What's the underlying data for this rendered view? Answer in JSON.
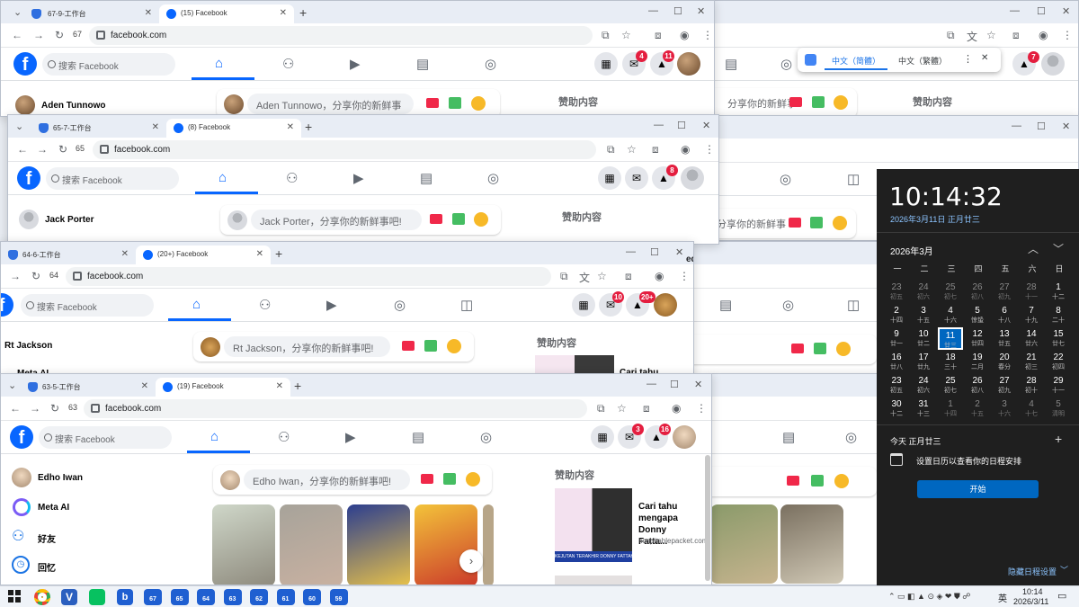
{
  "windows": {
    "w67": {
      "tab1": "67-9-工作台",
      "tab2": "(15) Facebook",
      "url": "facebook.com",
      "count": "67",
      "user": "Aden Tunnowo",
      "composer": "Aden Tunnowo，分享你的新鲜事",
      "sponsored": "赞助内容",
      "search": "搜索 Facebook",
      "badge_msg": "4",
      "badge_notif": "11"
    },
    "w65": {
      "tab1": "65-7-工作台",
      "tab2": "(8) Facebook",
      "url": "facebook.com",
      "count": "65",
      "user": "Jack Porter",
      "composer": "Jack Porter，分享你的新鲜事吧!",
      "sponsored": "赞助内容",
      "search": "搜索 Facebook",
      "badge_notif": "8"
    },
    "w64": {
      "tab1": "64-6-工作台",
      "tab2": "(20+) Facebook",
      "url": "facebook.com",
      "count": "64",
      "user": "Rt Jackson",
      "user2": "Meta AI",
      "composer": "Rt Jackson，分享你的新鲜事吧!",
      "sponsored": "赞助内容",
      "ad_text": "Cari tahu",
      "search": "搜索 Facebook",
      "badge_msg": "10",
      "badge_notif": "20+"
    },
    "w63": {
      "tab1": "63-5-工作台",
      "tab2": "(19) Facebook",
      "url": "facebook.com",
      "count": "63",
      "composer": "Edho Iwan，分享你的新鲜事吧!",
      "sponsored": "赞助内容",
      "search": "搜索 Facebook",
      "badge_msg": "3",
      "badge_notif": "16",
      "sidebar": [
        "Edho Iwan",
        "Meta AI",
        "好友",
        "回忆"
      ],
      "ad": {
        "title": "Cari tahu mengapa Donny Fatta...",
        "domain": "hospitablepacket.com",
        "caption": "KEJUTAN TERAKHIR DONNY FATTAH"
      }
    },
    "back": {
      "composer": "分享你的新鲜事",
      "sponsored": "赞助内容",
      "notif": "7",
      "partial": "ed"
    }
  },
  "translate_popup": {
    "opt1": "中文（简體）",
    "opt2": "中文（繁體）"
  },
  "calendar": {
    "time": "10:14:32",
    "date": "2026年3月11日 正月廿三",
    "month": "2026年3月",
    "weekdays": [
      "一",
      "二",
      "三",
      "四",
      "五",
      "六",
      "日"
    ],
    "days": [
      [
        "23",
        "初五"
      ],
      [
        "24",
        "初六"
      ],
      [
        "25",
        "初七"
      ],
      [
        "26",
        "初八"
      ],
      [
        "27",
        "初九"
      ],
      [
        "28",
        "十一"
      ],
      [
        "1",
        "十二"
      ],
      [
        "2",
        "十四"
      ],
      [
        "3",
        "十五"
      ],
      [
        "4",
        "十六"
      ],
      [
        "5",
        "惊蛰"
      ],
      [
        "6",
        "十八"
      ],
      [
        "7",
        "十九"
      ],
      [
        "8",
        "二十"
      ],
      [
        "9",
        "廿一"
      ],
      [
        "10",
        "廿二"
      ],
      [
        "11",
        "廿三"
      ],
      [
        "12",
        "廿四"
      ],
      [
        "13",
        "廿五"
      ],
      [
        "14",
        "廿六"
      ],
      [
        "15",
        "廿七"
      ],
      [
        "16",
        "廿八"
      ],
      [
        "17",
        "廿九"
      ],
      [
        "18",
        "三十"
      ],
      [
        "19",
        "二月"
      ],
      [
        "20",
        "春分"
      ],
      [
        "21",
        "初三"
      ],
      [
        "22",
        "初四"
      ],
      [
        "23",
        "初五"
      ],
      [
        "24",
        "初六"
      ],
      [
        "25",
        "初七"
      ],
      [
        "26",
        "初八"
      ],
      [
        "27",
        "初九"
      ],
      [
        "28",
        "初十"
      ],
      [
        "29",
        "十一"
      ],
      [
        "30",
        "十二"
      ],
      [
        "31",
        "十三"
      ],
      [
        "1",
        "十四"
      ],
      [
        "2",
        "十五"
      ],
      [
        "3",
        "十六"
      ],
      [
        "4",
        "十七"
      ],
      [
        "5",
        "清明"
      ]
    ],
    "today_label": "今天 正月廿三",
    "schedule_text": "设置日历以查看你的日程安排",
    "start_button": "开始",
    "hide_label": "隐藏日程设置"
  },
  "taskbar": {
    "time": "10:14",
    "date": "2026/3/11",
    "ime": "英",
    "apps": [
      "67",
      "65",
      "64",
      "63",
      "62",
      "61",
      "60",
      "59"
    ]
  }
}
